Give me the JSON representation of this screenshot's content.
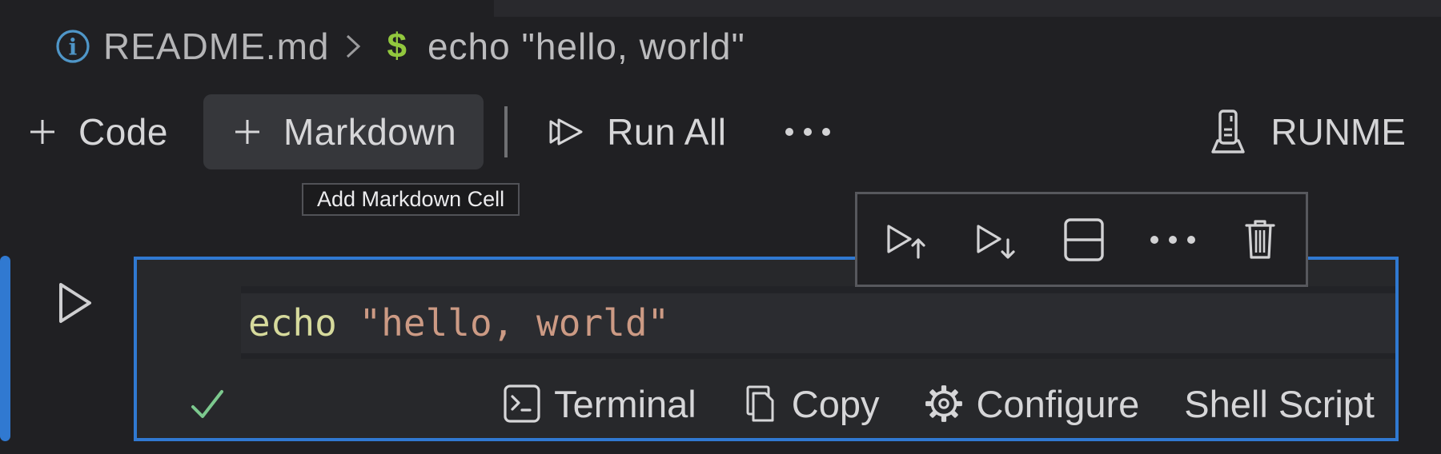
{
  "breadcrumb": {
    "info_icon": "info-icon",
    "file": "README.md",
    "separator": ">",
    "cell_symbol": "$",
    "cell_title": "echo \"hello, world\""
  },
  "notebook_toolbar": {
    "add_code_label": "Code",
    "add_markdown_label": "Markdown",
    "run_all_label": "Run All",
    "more_actions_icon": "ellipsis-icon",
    "kernel_icon": "runme-logo-icon",
    "kernel_label": "RUNME"
  },
  "tooltip": {
    "text": "Add Markdown Cell"
  },
  "cell_toolbar": {
    "items": [
      {
        "icon": "execute-above-icon"
      },
      {
        "icon": "execute-below-icon"
      },
      {
        "icon": "split-cell-icon"
      },
      {
        "icon": "ellipsis-icon"
      },
      {
        "icon": "trash-icon"
      }
    ]
  },
  "cell": {
    "run_icon": "run-cell-icon",
    "code": {
      "keyword": "echo",
      "space": " ",
      "string": "\"hello, world\""
    },
    "status_bar": {
      "success_icon": "check-icon",
      "items": [
        {
          "icon": "terminal-icon",
          "label": "Terminal"
        },
        {
          "icon": "copy-icon",
          "label": "Copy"
        },
        {
          "icon": "gear-icon",
          "label": "Configure"
        },
        {
          "icon": "",
          "label": "Shell Script"
        }
      ]
    }
  },
  "colors": {
    "focus_border_blue": "#3079d1",
    "code_keyword": "#d6da9c",
    "code_string": "#cc9a84",
    "success_green": "#7cc98e",
    "prompt_green": "#92c83e",
    "info_blue": "#4f96c8"
  }
}
